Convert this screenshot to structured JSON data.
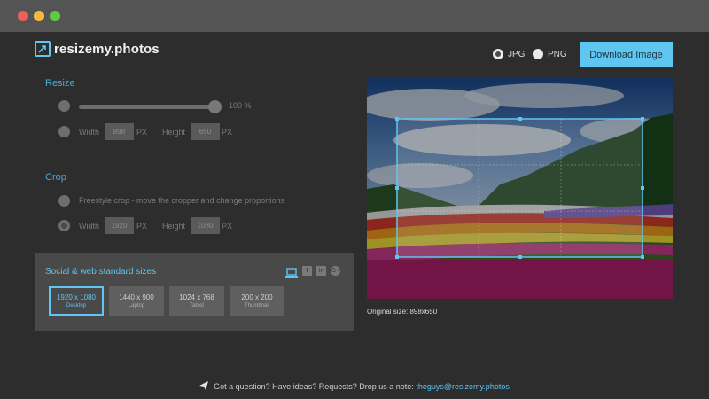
{
  "app": {
    "name": "resizemy.photos"
  },
  "format": {
    "jpg_label": "JPG",
    "png_label": "PNG",
    "selected": "JPG"
  },
  "download": {
    "label": "Download Image"
  },
  "resize": {
    "title": "Resize",
    "percent_label": "100 %",
    "width_label": "Width",
    "width_value": "898",
    "px": "PX",
    "height_label": "Height",
    "height_value": "650"
  },
  "crop": {
    "title": "Crop",
    "freestyle_label": "Freestyle crop - move the cropper and change proportions",
    "width_label": "Width",
    "width_value": "1920",
    "px": "PX",
    "height_label": "Height",
    "height_value": "1080"
  },
  "social": {
    "title": "Social & web standard sizes",
    "icons": [
      "laptop-icon",
      "facebook-icon",
      "linkedin-icon",
      "google-plus-icon"
    ],
    "sizes": [
      {
        "dim": "1920 x 1080",
        "name": "Desktop"
      },
      {
        "dim": "1440 x 900",
        "name": "Laptop"
      },
      {
        "dim": "1024 x 768",
        "name": "Tablet"
      },
      {
        "dim": "200 x 200",
        "name": "Thumbnail"
      }
    ],
    "selected": "Desktop"
  },
  "preview": {
    "original_size": "Original size: 898x650"
  },
  "footer": {
    "text": "Got a question? Have ideas? Requests? Drop us a note:",
    "email": "theguys@resizemy.photos"
  },
  "colors": {
    "accent": "#5ec6f0",
    "background": "#2e2d2e",
    "panel": "#4a494a"
  }
}
